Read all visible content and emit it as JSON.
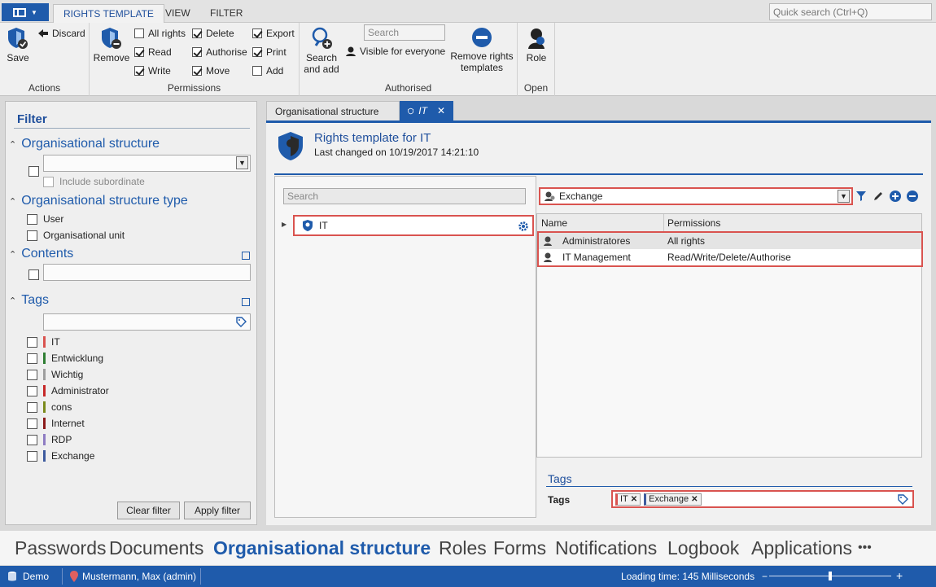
{
  "topbar": {
    "tabs": [
      "RIGHTS TEMPLATE",
      "VIEW",
      "FILTER"
    ],
    "quick_search_placeholder": "Quick search (Ctrl+Q)"
  },
  "ribbon": {
    "actions": {
      "save": "Save",
      "discard": "Discard",
      "group": "Actions"
    },
    "permissions": {
      "remove": "Remove",
      "group": "Permissions",
      "items": [
        {
          "label": "All rights",
          "checked": false
        },
        {
          "label": "Read",
          "checked": true
        },
        {
          "label": "Write",
          "checked": true
        },
        {
          "label": "Delete",
          "checked": true
        },
        {
          "label": "Authorise",
          "checked": true
        },
        {
          "label": "Move",
          "checked": true
        },
        {
          "label": "Export",
          "checked": true
        },
        {
          "label": "Print",
          "checked": true
        },
        {
          "label": "Add",
          "checked": false
        }
      ]
    },
    "authorised": {
      "search_and_add_line1": "Search",
      "search_and_add_line2": "and add",
      "search_placeholder": "Search",
      "visible_for_everyone": "Visible for everyone",
      "remove_templates_line1": "Remove rights",
      "remove_templates_line2": "templates",
      "group": "Authorised"
    },
    "open": {
      "role": "Role",
      "group": "Open"
    }
  },
  "filter": {
    "title": "Filter",
    "org_structure": {
      "title": "Organisational structure",
      "include_subordinate": "Include subordinate"
    },
    "org_type": {
      "title": "Organisational structure type",
      "options": [
        "User",
        "Organisational unit"
      ]
    },
    "contents": {
      "title": "Contents"
    },
    "tags": {
      "title": "Tags",
      "items": [
        {
          "label": "IT",
          "color": "#d9534f"
        },
        {
          "label": "Entwicklung",
          "color": "#2e7d32"
        },
        {
          "label": "Wichtig",
          "color": "#9e9e9e"
        },
        {
          "label": "Administrator",
          "color": "#c62828"
        },
        {
          "label": "cons",
          "color": "#7a8a1c"
        },
        {
          "label": "Internet",
          "color": "#8b1a1a"
        },
        {
          "label": "RDP",
          "color": "#8e7cc3"
        },
        {
          "label": "Exchange",
          "color": "#3d5a9e"
        }
      ]
    },
    "clear_filter": "Clear filter",
    "apply_filter": "Apply filter"
  },
  "doc_tabs": {
    "org": "Organisational structure",
    "it": "IT"
  },
  "doc": {
    "title": "Rights template for IT",
    "subtitle": "Last changed on 10/19/2017 14:21:10",
    "search_placeholder": "Search",
    "tree_item": "IT",
    "role_combo": "Exchange",
    "grid": {
      "columns": [
        "Name",
        "Permissions"
      ],
      "rows": [
        {
          "name": "Administratores",
          "permissions": "All rights"
        },
        {
          "name": "IT Management",
          "permissions": "Read/Write/Delete/Authorise"
        }
      ]
    },
    "tags_section": "Tags",
    "tags_label": "Tags",
    "tags": [
      {
        "label": "IT",
        "color": "#d9534f"
      },
      {
        "label": "Exchange",
        "color": "#3d5a9e"
      }
    ]
  },
  "modules": [
    "Passwords",
    "Documents",
    "Organisational structure",
    "Roles",
    "Forms",
    "Notifications",
    "Logbook",
    "Applications",
    "•••"
  ],
  "active_module": "Organisational structure",
  "statusbar": {
    "db": "Demo",
    "user": "Mustermann, Max (admin)",
    "loading": "Loading time: 145 Milliseconds",
    "zoom_minus": "−",
    "zoom_plus": "+"
  }
}
